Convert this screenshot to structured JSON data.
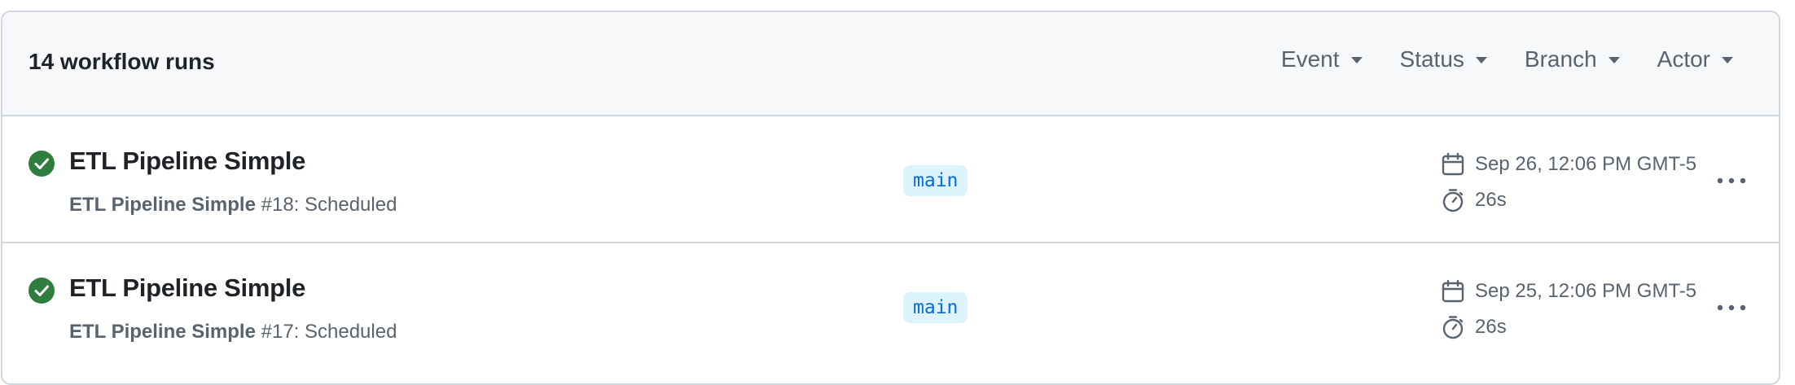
{
  "header": {
    "runs_count": "14 workflow runs",
    "filters": [
      {
        "label": "Event"
      },
      {
        "label": "Status"
      },
      {
        "label": "Branch"
      },
      {
        "label": "Actor"
      }
    ]
  },
  "runs": [
    {
      "title": "ETL Pipeline Simple",
      "workflow": "ETL Pipeline Simple",
      "run_detail": " #18: Scheduled",
      "branch": "main",
      "date": "Sep 26, 12:06 PM GMT-5",
      "duration": "26s",
      "status": "success"
    },
    {
      "title": "ETL Pipeline Simple",
      "workflow": "ETL Pipeline Simple",
      "run_detail": " #17: Scheduled",
      "branch": "main",
      "date": "Sep 25, 12:06 PM GMT-5",
      "duration": "26s",
      "status": "success"
    }
  ],
  "colors": {
    "success": "#2f7d3f",
    "branch_bg": "#ddf4ff",
    "branch_text": "#0969da",
    "muted": "#59636e"
  },
  "icons": {
    "status": "check-circle-fill-icon",
    "date": "calendar-icon",
    "duration": "stopwatch-icon",
    "menu": "kebab-horizontal-icon"
  }
}
